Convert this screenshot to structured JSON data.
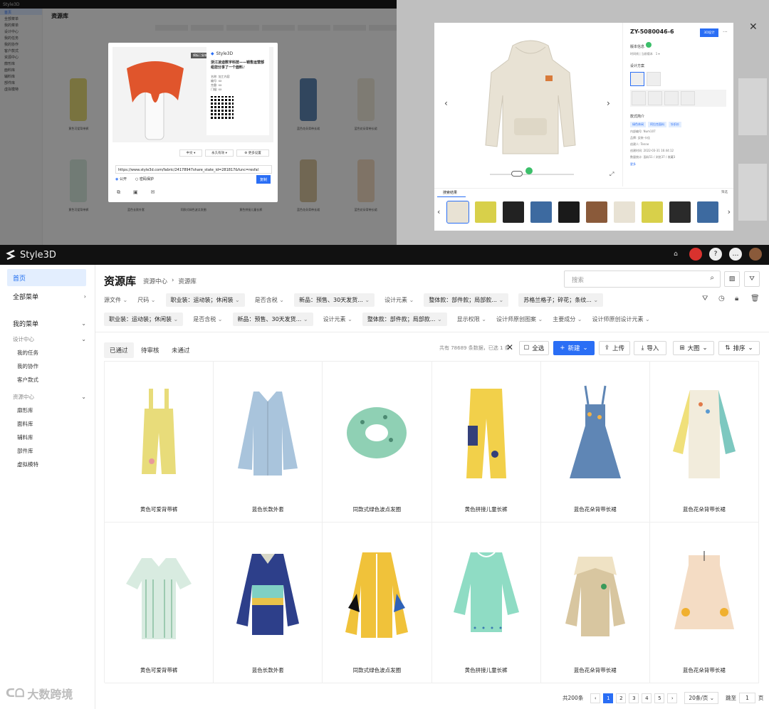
{
  "top_left": {
    "app": "Style3D",
    "title": "资源库",
    "sidebar": [
      "首页",
      "全部菜单",
      "我的菜单",
      "设计中心",
      "我的任务",
      "我的协作",
      "客户款式",
      "资源中心",
      "廓形库",
      "面料库",
      "辅料库",
      "部件库",
      "虚拟模特"
    ],
    "modal": {
      "tag": "模板已复制",
      "brand": "Style3D",
      "headline": "浙江凌迪数字科技——销售运营部组您分享了一个面料♪",
      "meta": [
        "名称: 加工内容",
        "编号: xx",
        "克重: xx",
        "门幅: xx"
      ],
      "lang": "中文",
      "validity": "永久有效",
      "more": "更多设置",
      "url": "https://www.style3d.com/fabric/24178947share_state_id=281817&func=resfal",
      "public": "公开",
      "password": "密码保护",
      "copy": "复制"
    }
  },
  "top_right": {
    "product_id": "ZY-5080046-6",
    "btn_3d": "3D设计",
    "version_label": "版本信息",
    "version_select": "1",
    "design_label": "设计方案",
    "style_info_label": "款式简介",
    "info_tags": [
      "绿色休闲",
      "阿拉克面料",
      "针织衫"
    ],
    "info_lines": [
      "内部编号: Num107",
      "品牌: 女装-卡佳",
      "创建人: Tenne",
      "创建时间: 2022-03-31 16:44:12",
      "数量统计: 面料51 / 浏览37 / 收藏3"
    ],
    "more": "更多",
    "bottom_title": "搜索结果",
    "bottom_filter": "筛选"
  },
  "header": {
    "brand": "Style3D",
    "icons": [
      "home-icon",
      "flag-icon",
      "help-icon",
      "chat-icon",
      "avatar"
    ]
  },
  "sidebar": {
    "home": "首页",
    "all_menu": "全部菜单",
    "my_menu": "我的菜单",
    "design_center": "设计中心",
    "design_items": [
      "我的任务",
      "我的协作",
      "客户款式"
    ],
    "resource_center": "资源中心",
    "resource_items": [
      "廓形库",
      "面料库",
      "辅料库",
      "部件库",
      "虚拟模特"
    ]
  },
  "page": {
    "title": "资源库",
    "breadcrumb": [
      "资源中心",
      "›",
      "资源库"
    ],
    "search_placeholder": "搜索"
  },
  "filters_row1": [
    {
      "label": "源文件",
      "type": "chip"
    },
    {
      "label": "尺码",
      "type": "chip"
    },
    {
      "label": "职业装：运动装；休闲装",
      "type": "sel"
    },
    {
      "label": "是否含税",
      "type": "chip"
    },
    {
      "label": "新品：预售、30天发货...",
      "type": "sel"
    },
    {
      "label": "设计元素",
      "type": "chip"
    },
    {
      "label": "整体款：部件款；局部款...",
      "type": "sel"
    },
    {
      "label": "苏格兰格子；碎花；条纹...",
      "type": "sel"
    }
  ],
  "filters_row2": [
    {
      "label": "职业装：运动装；休闲装",
      "type": "sel"
    },
    {
      "label": "是否含税",
      "type": "chip"
    },
    {
      "label": "新品：预售、30天发货...",
      "type": "sel"
    },
    {
      "label": "设计元素",
      "type": "chip"
    },
    {
      "label": "整体款：部件款；局部款...",
      "type": "sel"
    },
    {
      "label": "显示权限",
      "type": "chip"
    },
    {
      "label": "设计师原创图案",
      "type": "chip"
    },
    {
      "label": "主要成分",
      "type": "chip"
    },
    {
      "label": "设计师原创设计元素",
      "type": "chip"
    }
  ],
  "tabs": [
    "已通过",
    "待审核",
    "未通过"
  ],
  "count_text": "共有 78689 条数据，已选 1 条",
  "toolbar": {
    "select_all": "全选",
    "new": "新建",
    "upload": "上传",
    "import": "导入",
    "view": "大图",
    "sort": "排序"
  },
  "items": [
    {
      "name": "黄色可爱背带裤",
      "color": "#e8dc7a",
      "icon": "overalls"
    },
    {
      "name": "蓝色长款外套",
      "color": "#a9c4dc",
      "icon": "coat"
    },
    {
      "name": "同款式绿色波点发圈",
      "color": "#8fd0b4",
      "icon": "scrunchie"
    },
    {
      "name": "黄色拼接儿童长裤",
      "color": "#f2d04a",
      "icon": "pants"
    },
    {
      "name": "蓝色花朵背带长裙",
      "color": "#5f86b5",
      "icon": "dress"
    },
    {
      "name": "蓝色花朵背带长裙",
      "color": "#f2ecdc",
      "icon": "blouse"
    },
    {
      "name": "黄色可爱背带裤",
      "color": "#d8ebe0",
      "icon": "shirt"
    },
    {
      "name": "蓝色长款外套",
      "color": "#2d3f8a",
      "icon": "polo"
    },
    {
      "name": "同款式绿色波点发圈",
      "color": "#f0c23a",
      "icon": "jacket"
    },
    {
      "name": "黄色拼接儿童长裤",
      "color": "#8fdcc4",
      "icon": "top"
    },
    {
      "name": "蓝色花朵背带长裙",
      "color": "#d8c6a0",
      "icon": "coat2"
    },
    {
      "name": "蓝色花朵背带长裙",
      "color": "#f4dcc4",
      "icon": "skirt"
    }
  ],
  "pagination": {
    "total": "共200条",
    "pages": [
      "1",
      "2",
      "3",
      "4",
      "5"
    ],
    "per_page": "20条/页",
    "jump": "跳至",
    "page_input": "1",
    "page_unit": "页"
  },
  "watermark": "大数跨境",
  "colors": {
    "accent": "#2a6ef5",
    "topbar": "#111111",
    "active_bg": "#e3eefe"
  }
}
